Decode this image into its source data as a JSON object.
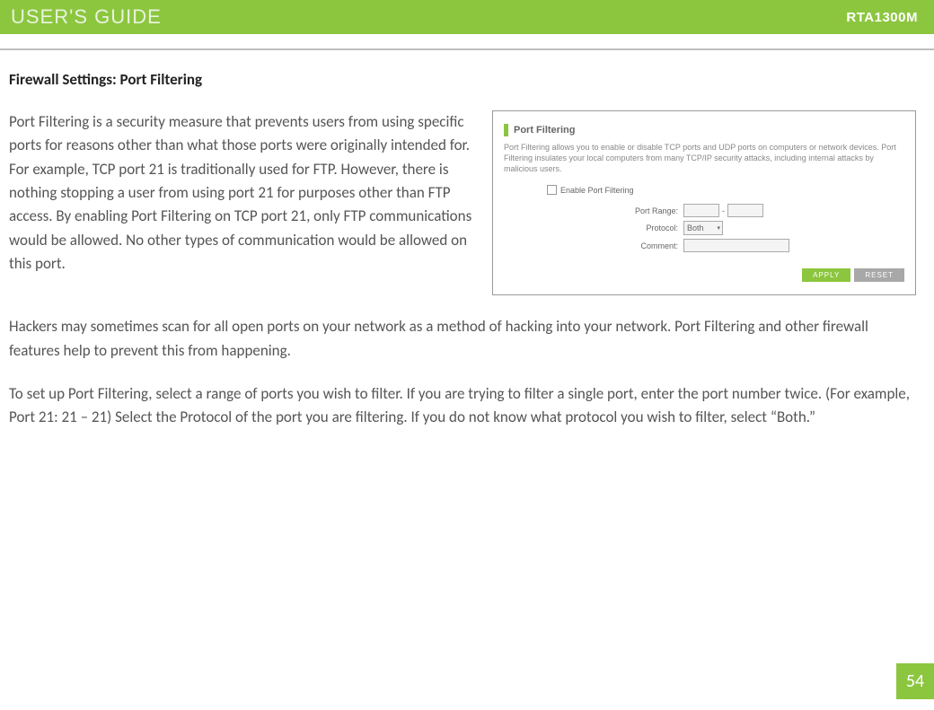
{
  "header": {
    "guide_label": "USER'S GUIDE",
    "model": "RTA1300M"
  },
  "section_title": "Firewall Settings: Port Filtering",
  "intro": "Port Filtering is a security measure that prevents users from using specific ports for reasons other than what those ports were originally intended for.  For example, TCP port 21 is traditionally used for FTP.  However, there is nothing stopping a user from using port 21 for purposes other than FTP access.  By enabling Port Filtering on TCP port 21, only FTP communications would be allowed.  No other types of communication would be allowed on this port.",
  "para2": "Hackers may sometimes scan for all open ports on your network as a method of hacking into your network.  Port Filtering and other firewall features help to prevent this from happening.",
  "para3": "To set up Port Filtering, select a range of ports you wish to filter.  If you are trying to filter a single port, enter the port number twice.  (For example, Port 21:  21 – 21) Select the Protocol of the port you are filtering.  If you do not know what protocol you wish to filter, select “Both.”",
  "panel": {
    "title": "Port Filtering",
    "description": "Port Filtering allows you to enable or disable TCP ports and UDP ports on computers or network devices. Port Filtering insulates your local computers from many TCP/IP security attacks, including internal attacks by malicious users.",
    "enable_label": "Enable Port Filtering",
    "port_range_label": "Port Range:",
    "protocol_label": "Protocol:",
    "protocol_value": "Both",
    "comment_label": "Comment:",
    "apply": "APPLY",
    "reset": "RESET"
  },
  "page_number": "54"
}
